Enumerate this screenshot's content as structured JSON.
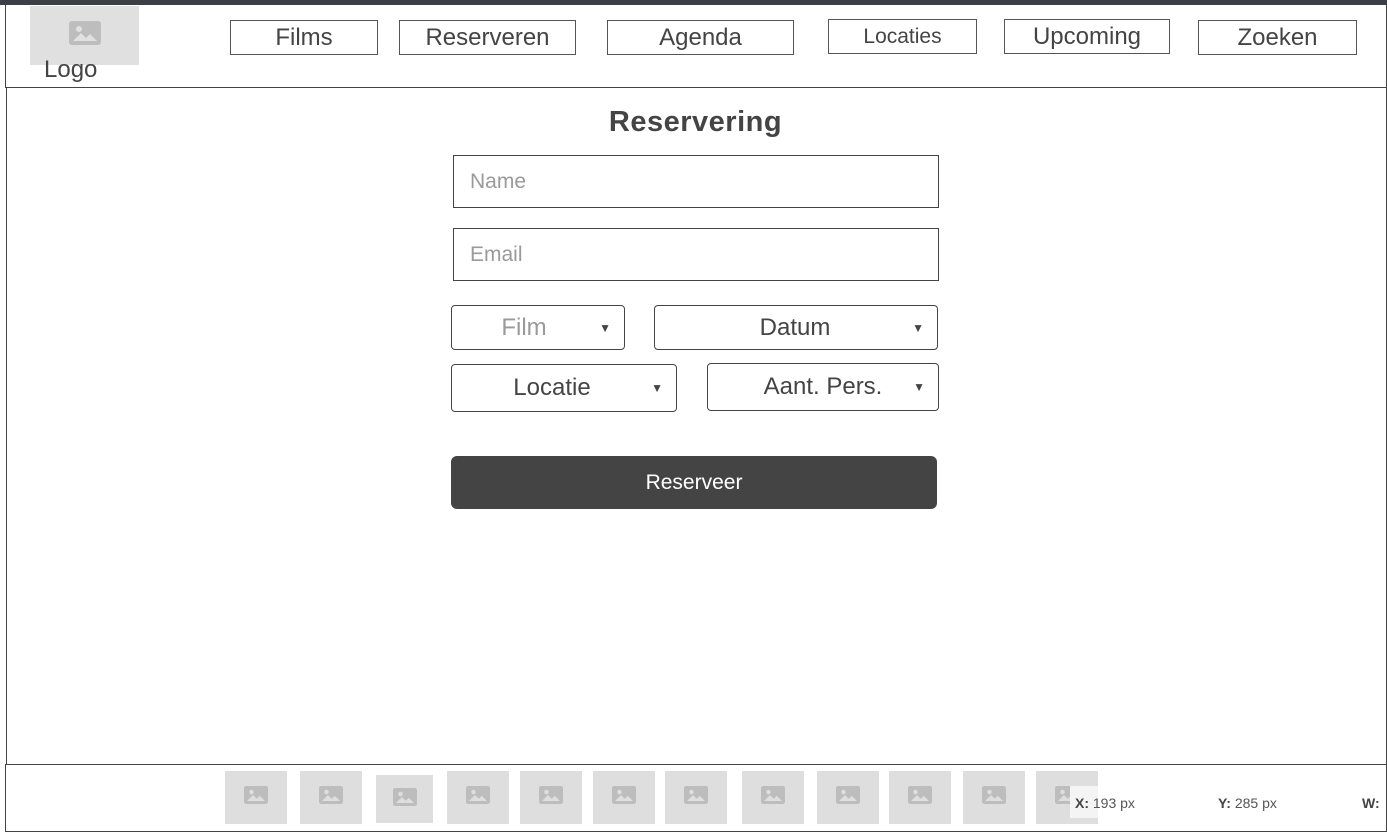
{
  "header": {
    "logo_label": "Logo",
    "nav": [
      {
        "label": "Films"
      },
      {
        "label": "Reserveren"
      },
      {
        "label": "Agenda"
      },
      {
        "label": "Locaties"
      },
      {
        "label": "Upcoming"
      },
      {
        "label": "Zoeken"
      }
    ]
  },
  "form": {
    "title": "Reservering",
    "name_placeholder": "Name",
    "email_placeholder": "Email",
    "film_select": "Film",
    "datum_select": "Datum",
    "locatie_select": "Locatie",
    "persons_select": "Aant. Pers.",
    "submit_label": "Reserveer"
  },
  "footer": {
    "thumbnail_count": 12,
    "icon": "image-placeholder-icon"
  },
  "status": {
    "x_label": "X:",
    "x_value": "193 px",
    "y_label": "Y:",
    "y_value": "285 px",
    "w_label": "W:"
  },
  "colors": {
    "dark_button": "#444444",
    "placeholder_gray": "#e0e0e0",
    "border": "#444444"
  }
}
